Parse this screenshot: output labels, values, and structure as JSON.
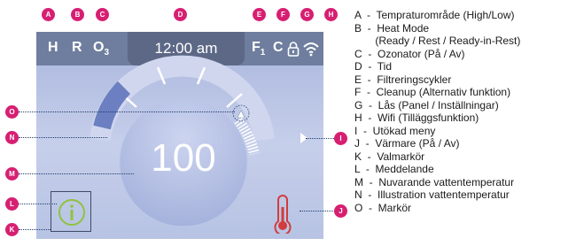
{
  "status_bar": {
    "temp_range": "H",
    "heat_mode": "R",
    "ozonator": "O",
    "ozonator_sub": "3",
    "time": "12:00 am",
    "filter": "F",
    "filter_sub": "1",
    "cleanup": "C",
    "lock_icon": "lock-icon",
    "wifi_icon": "wifi-icon"
  },
  "main": {
    "water_temperature": "100",
    "message_icon": "info-icon",
    "heater_icon": "thermometer-icon",
    "extended_menu_icon": "caret-right-icon"
  },
  "callouts": {
    "a": "A",
    "b": "B",
    "c": "C",
    "d": "D",
    "e": "E",
    "f": "F",
    "g": "G",
    "h": "H",
    "i": "I",
    "j": "J",
    "k": "K",
    "l": "L",
    "m": "M",
    "n": "N",
    "o": "O"
  },
  "legend": [
    "A  -  Tempraturområde (High/Low)",
    "B  -  Heat Mode",
    "       (Ready / Rest / Ready-in-Rest)",
    "C  -  Ozonator (På / Av)",
    "D  -  Tid",
    "E  -  Filtreringscykler",
    "F  -  Cleanup (Alternativ funktion)",
    "G  -  Lås (Panel / Inställningar)",
    "H  -  Wifi (Tilläggsfunktion)",
    "I  -  Utökad meny",
    "J  -  Värmare (På / Av)",
    "K  -  Valmarkör",
    "L  -  Meddelande",
    "M  -  Nuvarande vattentemperatur",
    "N  -  Illustration vattentemperatur",
    "O  -  Markör"
  ],
  "colors": {
    "callout": "#d71f72",
    "status_bar": "#6f7e9e",
    "clock_bg": "#5c6885",
    "screen_top": "#a9b6dd",
    "dial": "#b9c4e6",
    "arc": "#6b7fc1",
    "heater": "#d23c3c",
    "message": "#8fc23f"
  }
}
